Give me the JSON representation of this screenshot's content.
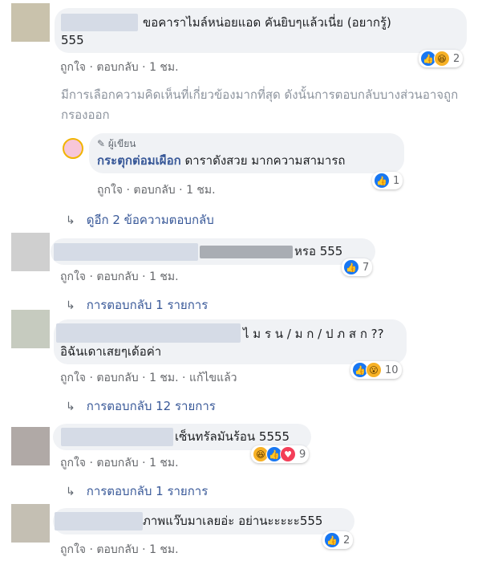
{
  "actions": {
    "like": "ถูกใจ",
    "reply": "ตอบกลับ",
    "time": "1 ชม.",
    "edited": "แก้ไขแล้ว",
    "sep": " · "
  },
  "comments": [
    {
      "text_line1": "ขอคาราไมล์หน่อยแอด คันยิบๆแล้วเนี่ย (อยากรู้)",
      "text_line2": "555",
      "reaction_count": "2",
      "reactions": [
        "like-icon",
        "haha-icon"
      ]
    },
    {
      "text": "หรอ 555",
      "reaction_count": "7",
      "reactions": [
        "like-icon"
      ],
      "replies": "ดูอีก 2 ข้อความตอบกลับ"
    },
    {
      "text_line1": "ไ ม ร น / ม ก / ป ภ ส ก ??",
      "text_line2": "อิฉันเดาเสยๆเด้อค่า",
      "reaction_count": "10",
      "reactions": [
        "like-icon",
        "wow-icon"
      ],
      "replies": "การตอบกลับ 12 รายการ"
    },
    {
      "text": "เซ็นทรัลมันร้อน 5555",
      "reaction_count": "9",
      "reactions": [
        "haha-icon",
        "like-icon",
        "love-icon"
      ],
      "replies": "การตอบกลับ 1 รายการ"
    },
    {
      "text": "ภาพแว๊บมาเลยอ่ะ อย่านะะะะะ555",
      "reaction_count": "2",
      "reactions": [
        "like-icon"
      ]
    }
  ],
  "first_replies": "การตอบกลับ 1 รายการ",
  "notice": "มีการเลือกความคิดเห็นที่เกี่ยวข้องมากที่สุด ดังนั้นการตอบกลับบางส่วนอาจถูกกรองออก",
  "author_reply": {
    "badge": "ผู้เขียน",
    "name": "กระตุกต่อมเผือก",
    "text": " ดาราดังสวย มากความสามารถ",
    "reaction_count": "1"
  },
  "colors": {
    "link": "#385898",
    "meta": "#65676b",
    "bubble": "#f0f2f5",
    "like": "#1877f2"
  }
}
